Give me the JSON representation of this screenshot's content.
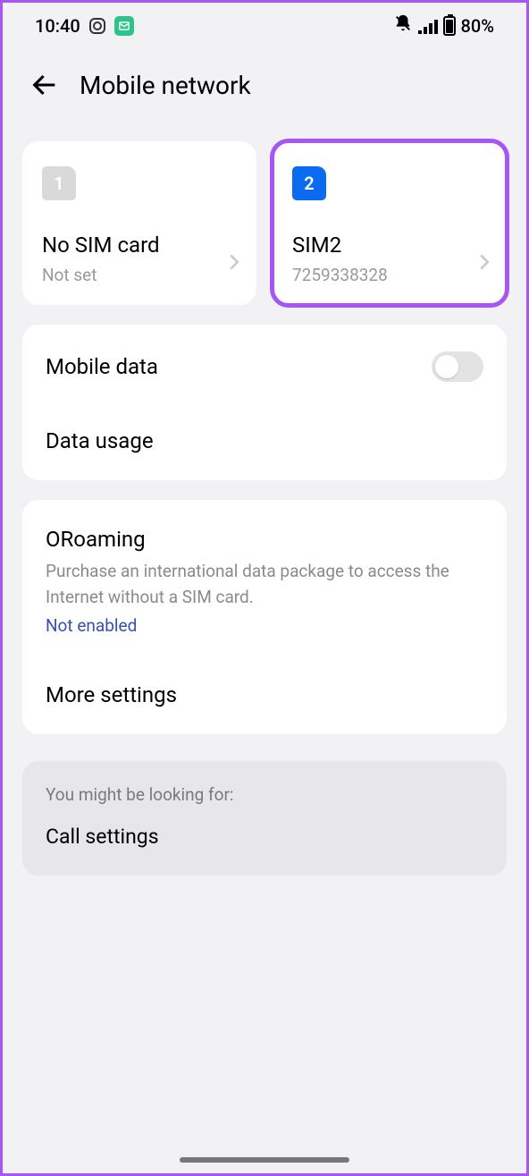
{
  "statusBar": {
    "time": "10:40",
    "batteryPercent": "80%"
  },
  "header": {
    "title": "Mobile network"
  },
  "sims": {
    "sim1": {
      "chip": "1",
      "title": "No SIM card",
      "sub": "Not set"
    },
    "sim2": {
      "chip": "2",
      "title": "SIM2",
      "sub": "7259338328"
    }
  },
  "settings": {
    "mobileData": "Mobile data",
    "dataUsage": "Data usage",
    "oroamingTitle": "ORoaming",
    "oroamingDesc": "Purchase an international data package to access the Internet without a SIM card.",
    "oroamingStatus": "Not enabled",
    "moreSettings": "More settings"
  },
  "hint": {
    "label": "You might be looking for:",
    "callSettings": "Call settings"
  }
}
